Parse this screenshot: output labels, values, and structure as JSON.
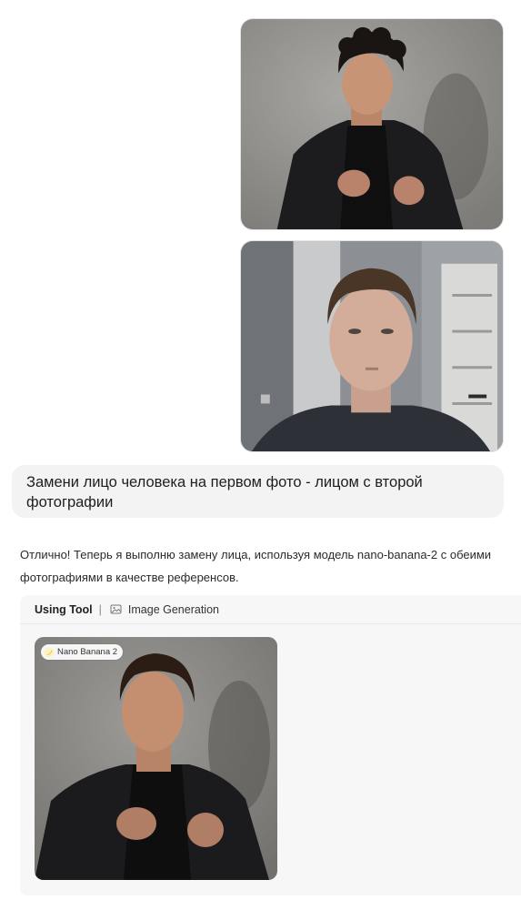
{
  "conversation": {
    "user_images": [
      {
        "alt_name": "user-photo-1"
      },
      {
        "alt_name": "user-photo-2"
      }
    ],
    "user_message": "Замени лицо человека на первом фото - лицом с второй фотографии",
    "assistant_message": "Отлично! Теперь я выполню замену лица, используя модель nano-banana-2 с обеими фотографиями в качестве референсов.",
    "tool": {
      "label": "Using Tool",
      "separator": "|",
      "name": "Image Generation",
      "icon": "image-icon",
      "result": {
        "badge": "Nano Banana 2",
        "badge_icon": "banana-icon"
      }
    }
  },
  "colors": {
    "bubble_bg": "#f3f3f3",
    "card_bg": "#f7f7f7",
    "text": "#222222"
  }
}
